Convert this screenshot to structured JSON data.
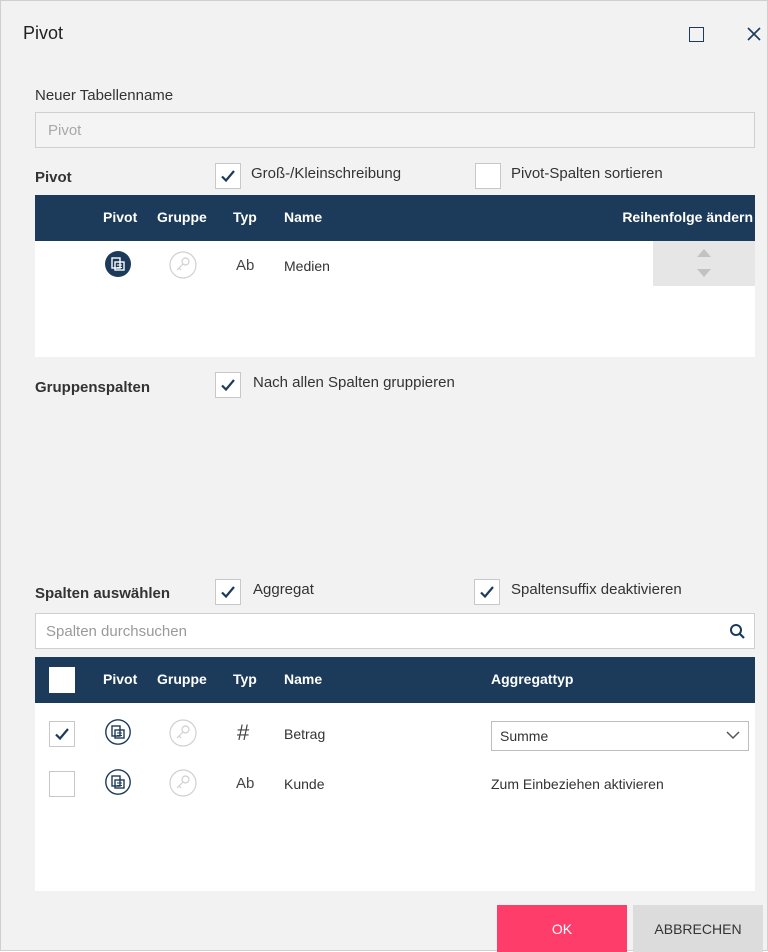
{
  "dialog": {
    "title": "Pivot"
  },
  "new_table": {
    "label": "Neuer Tabellenname",
    "placeholder": "Pivot"
  },
  "pivot_section": {
    "label": "Pivot",
    "case_checkbox": {
      "label": "Groß-/Kleinschreibung",
      "checked": true
    },
    "sort_checkbox": {
      "label": "Pivot-Spalten sortieren",
      "checked": false
    },
    "headers": {
      "pivot": "Pivot",
      "group": "Gruppe",
      "type": "Typ",
      "name": "Name",
      "order": "Reihenfolge ändern"
    },
    "rows": [
      {
        "type": "Ab",
        "name": "Medien"
      }
    ]
  },
  "group_section": {
    "label": "Gruppenspalten",
    "group_all_checkbox": {
      "label": "Nach allen Spalten gruppieren",
      "checked": true
    }
  },
  "columns_section": {
    "label": "Spalten auswählen",
    "aggregate_checkbox": {
      "label": "Aggregat",
      "checked": true
    },
    "suffix_checkbox": {
      "label": "Spaltensuffix deaktivieren",
      "checked": true
    },
    "search_placeholder": "Spalten durchsuchen",
    "headers": {
      "pivot": "Pivot",
      "group": "Gruppe",
      "type": "Typ",
      "name": "Name",
      "agg": "Aggregattyp"
    },
    "rows": [
      {
        "checked": true,
        "type": "#",
        "name": "Betrag",
        "agg_value": "Summe"
      },
      {
        "checked": false,
        "type": "Ab",
        "name": "Kunde",
        "agg_text": "Zum Einbeziehen aktivieren"
      }
    ]
  },
  "buttons": {
    "ok": "OK",
    "cancel": "ABBRECHEN"
  },
  "colors": {
    "header": "#1c3a5a",
    "accent": "#ff3d6a",
    "pivot_icon": "#1c3a5a"
  },
  "icons": {
    "maximize": "maximize-icon",
    "close": "close-icon",
    "search": "search-icon",
    "pivot": "pivot-icon",
    "key": "key-icon",
    "check": "check-icon"
  }
}
